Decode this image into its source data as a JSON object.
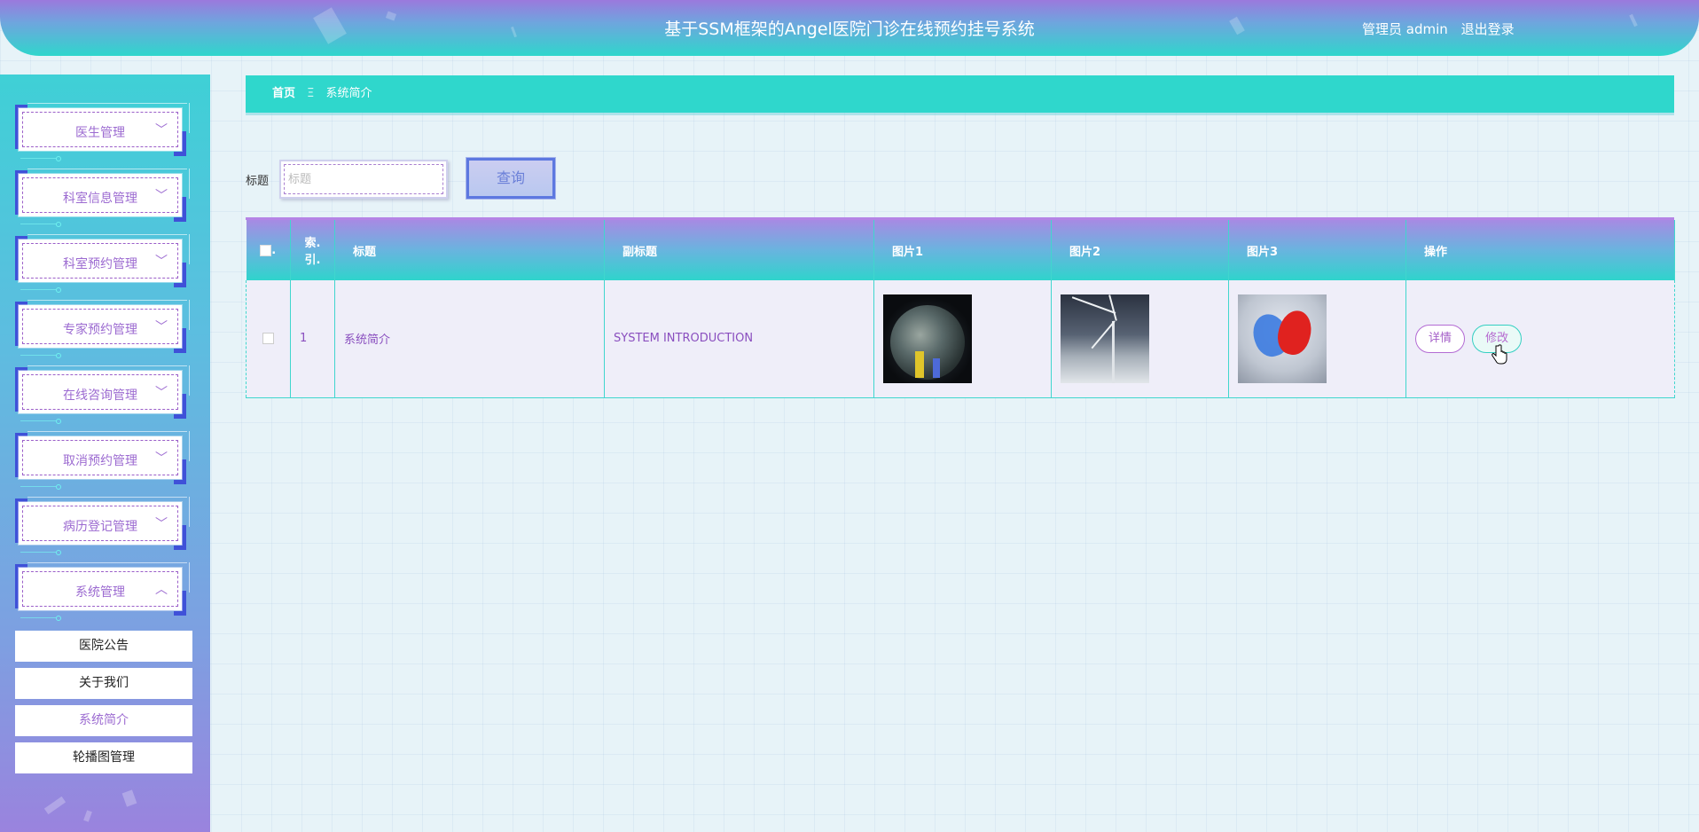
{
  "header": {
    "title": "基于SSM框架的Angel医院门诊在线预约挂号系统",
    "user_label": "管理员 admin",
    "logout_label": "退出登录"
  },
  "sidebar": {
    "menus": [
      {
        "label": "医生管理",
        "expanded": false
      },
      {
        "label": "科室信息管理",
        "expanded": false
      },
      {
        "label": "科室预约管理",
        "expanded": false
      },
      {
        "label": "专家预约管理",
        "expanded": false
      },
      {
        "label": "在线咨询管理",
        "expanded": false
      },
      {
        "label": "取消预约管理",
        "expanded": false
      },
      {
        "label": "病历登记管理",
        "expanded": false
      },
      {
        "label": "系统管理",
        "expanded": true
      }
    ],
    "submenu": [
      {
        "label": "医院公告",
        "active": false
      },
      {
        "label": "关于我们",
        "active": false
      },
      {
        "label": "系统简介",
        "active": true
      },
      {
        "label": "轮播图管理",
        "active": false
      }
    ]
  },
  "breadcrumb": {
    "home": "首页",
    "separator": "Ξ",
    "current": "系统简介"
  },
  "search": {
    "label": "标题",
    "placeholder": "标题",
    "value": "",
    "button_label": "查询"
  },
  "table": {
    "columns": [
      "索引",
      "标题",
      "副标题",
      "图片1",
      "图片2",
      "图片3",
      "操作"
    ],
    "index_header_lines": [
      "索.",
      "引."
    ],
    "rows": [
      {
        "index": "1",
        "title": "系统简介",
        "subtitle": "SYSTEM INTRODUCTION",
        "images": [
          "earth-figures-image",
          "wind-turbine-image",
          "hearts-image"
        ],
        "actions": {
          "detail": "详情",
          "edit": "修改"
        }
      }
    ]
  },
  "colors": {
    "accent_teal": "#2fd7cc",
    "accent_purple": "#9c6bd1",
    "accent_blue": "#3f51d8"
  }
}
